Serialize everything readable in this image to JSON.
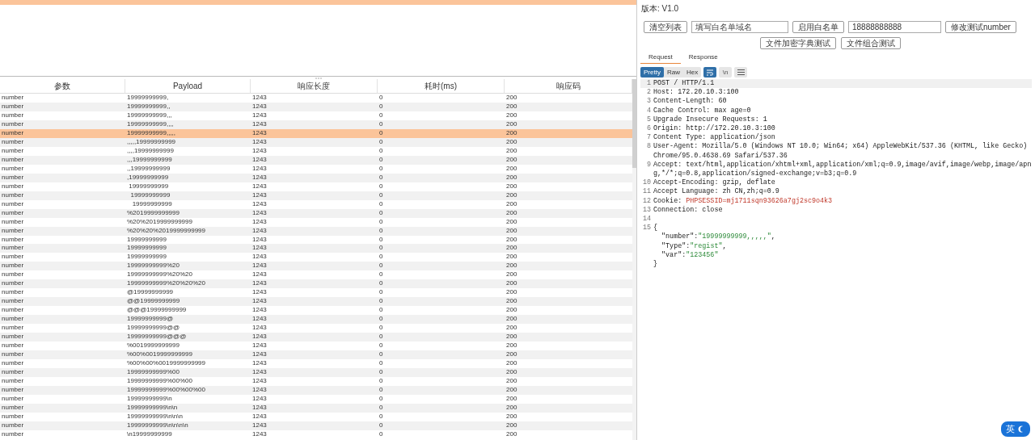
{
  "top_table": {
    "rows": [
      {
        "selected": true
      }
    ]
  },
  "results_table": {
    "columns": [
      "参数",
      "Payload",
      "响应长度",
      "耗时(ms)",
      "响应码"
    ],
    "rows": [
      {
        "selected": false,
        "cells": [
          "number",
          "19999999999,",
          "1243",
          "0",
          "200"
        ]
      },
      {
        "selected": false,
        "cells": [
          "number",
          "19999999999,,",
          "1243",
          "0",
          "200"
        ]
      },
      {
        "selected": false,
        "cells": [
          "number",
          "19999999999,,,",
          "1243",
          "0",
          "200"
        ]
      },
      {
        "selected": false,
        "cells": [
          "number",
          "19999999999,,,,",
          "1243",
          "0",
          "200"
        ]
      },
      {
        "selected": true,
        "cells": [
          "number",
          "19999999999,,,,,",
          "1243",
          "0",
          "200"
        ]
      },
      {
        "selected": false,
        "cells": [
          "number",
          ",,,,,19999999999",
          "1243",
          "0",
          "200"
        ]
      },
      {
        "selected": false,
        "cells": [
          "number",
          ",,,,19999999999",
          "1243",
          "0",
          "200"
        ]
      },
      {
        "selected": false,
        "cells": [
          "number",
          ",,,19999999999",
          "1243",
          "0",
          "200"
        ]
      },
      {
        "selected": false,
        "cells": [
          "number",
          ",,19999999999",
          "1243",
          "0",
          "200"
        ]
      },
      {
        "selected": false,
        "cells": [
          "number",
          ",19999999999",
          "1243",
          "0",
          "200"
        ]
      },
      {
        "selected": false,
        "cells": [
          "number",
          " 19999999999",
          "1243",
          "0",
          "200"
        ]
      },
      {
        "selected": false,
        "cells": [
          "number",
          "  19999999999",
          "1243",
          "0",
          "200"
        ]
      },
      {
        "selected": false,
        "cells": [
          "number",
          "   19999999999",
          "1243",
          "0",
          "200"
        ]
      },
      {
        "selected": false,
        "cells": [
          "number",
          "%2019999999999",
          "1243",
          "0",
          "200"
        ]
      },
      {
        "selected": false,
        "cells": [
          "number",
          "%20%2019999999999",
          "1243",
          "0",
          "200"
        ]
      },
      {
        "selected": false,
        "cells": [
          "number",
          "%20%20%2019999999999",
          "1243",
          "0",
          "200"
        ]
      },
      {
        "selected": false,
        "cells": [
          "number",
          "19999999999",
          "1243",
          "0",
          "200"
        ]
      },
      {
        "selected": false,
        "cells": [
          "number",
          "19999999999",
          "1243",
          "0",
          "200"
        ]
      },
      {
        "selected": false,
        "cells": [
          "number",
          "19999999999",
          "1243",
          "0",
          "200"
        ]
      },
      {
        "selected": false,
        "cells": [
          "number",
          "19999999999%20",
          "1243",
          "0",
          "200"
        ]
      },
      {
        "selected": false,
        "cells": [
          "number",
          "19999999999%20%20",
          "1243",
          "0",
          "200"
        ]
      },
      {
        "selected": false,
        "cells": [
          "number",
          "19999999999%20%20%20",
          "1243",
          "0",
          "200"
        ]
      },
      {
        "selected": false,
        "cells": [
          "number",
          "@19999999999",
          "1243",
          "0",
          "200"
        ]
      },
      {
        "selected": false,
        "cells": [
          "number",
          "@@19999999999",
          "1243",
          "0",
          "200"
        ]
      },
      {
        "selected": false,
        "cells": [
          "number",
          "@@@19999999999",
          "1243",
          "0",
          "200"
        ]
      },
      {
        "selected": false,
        "cells": [
          "number",
          "19999999999@",
          "1243",
          "0",
          "200"
        ]
      },
      {
        "selected": false,
        "cells": [
          "number",
          "19999999999@@",
          "1243",
          "0",
          "200"
        ]
      },
      {
        "selected": false,
        "cells": [
          "number",
          "19999999999@@@",
          "1243",
          "0",
          "200"
        ]
      },
      {
        "selected": false,
        "cells": [
          "number",
          "%0019999999999",
          "1243",
          "0",
          "200"
        ]
      },
      {
        "selected": false,
        "cells": [
          "number",
          "%00%0019999999999",
          "1243",
          "0",
          "200"
        ]
      },
      {
        "selected": false,
        "cells": [
          "number",
          "%00%00%0019999999999",
          "1243",
          "0",
          "200"
        ]
      },
      {
        "selected": false,
        "cells": [
          "number",
          "19999999999%00",
          "1243",
          "0",
          "200"
        ]
      },
      {
        "selected": false,
        "cells": [
          "number",
          "19999999999%00%00",
          "1243",
          "0",
          "200"
        ]
      },
      {
        "selected": false,
        "cells": [
          "number",
          "19999999999%00%00%00",
          "1243",
          "0",
          "200"
        ]
      },
      {
        "selected": false,
        "cells": [
          "number",
          "19999999999\\n",
          "1243",
          "0",
          "200"
        ]
      },
      {
        "selected": false,
        "cells": [
          "number",
          "19999999999\\n\\n",
          "1243",
          "0",
          "200"
        ]
      },
      {
        "selected": false,
        "cells": [
          "number",
          "19999999999\\n\\n\\n",
          "1243",
          "0",
          "200"
        ]
      },
      {
        "selected": false,
        "cells": [
          "number",
          "19999999999\\n\\n\\n\\n",
          "1243",
          "0",
          "200"
        ]
      },
      {
        "selected": false,
        "cells": [
          "number",
          "\\n19999999999",
          "1243",
          "0",
          "200"
        ]
      }
    ]
  },
  "version": "版本: V1.0",
  "controls": [
    {
      "kind": "button",
      "label": "清空列表"
    },
    {
      "kind": "input",
      "placeholder": "填写白名单域名"
    },
    {
      "kind": "button",
      "label": "启用白名单"
    },
    {
      "kind": "input",
      "value": "18888888888"
    },
    {
      "kind": "button",
      "label": "修改测试number"
    }
  ],
  "actions": [
    "文件加密字典测试",
    "文件组合测试"
  ],
  "tabs": [
    {
      "label": "Request",
      "selected": true
    },
    {
      "label": "Response",
      "selected": false
    }
  ],
  "view_modes": [
    {
      "label": "Pretty",
      "selected": true
    },
    {
      "label": "Raw",
      "selected": false
    },
    {
      "label": "Hex",
      "selected": false
    }
  ],
  "toolbar": [
    {
      "kind": "wrap",
      "selected": true
    },
    {
      "kind": "newline",
      "label": "\\n",
      "selected": false
    },
    {
      "kind": "menu",
      "selected": false
    }
  ],
  "request_lines": [
    {
      "number": "1",
      "text": "POST / HTTP/1.1",
      "selected": true
    },
    {
      "number": "2",
      "text": "Host: 172.20.10.3:100",
      "selected": false
    },
    {
      "number": "3",
      "text": "Content-Length: 60",
      "selected": false
    },
    {
      "number": "4",
      "text": "Cache Control: max age=0",
      "selected": false
    },
    {
      "number": "5",
      "text": "Upgrade Insecure Requests: 1",
      "selected": false
    },
    {
      "number": "6",
      "text": "Origin: http://172.20.10.3:100",
      "selected": false
    },
    {
      "number": "7",
      "text": "Content Type: application/json",
      "selected": false
    },
    {
      "number": "8",
      "text": "User-Agent: Mozilla/5.0 (Windows NT 10.0; Win64; x64) AppleWebKit/537.36 (KHTML, like Gecko) Chrome/95.0.4638.69 Safari/537.36",
      "selected": false
    },
    {
      "number": "9",
      "text": "Accept: text/html,application/xhtml+xml,application/xml;q=0.9,image/avif,image/webp,image/apng,*/*;q=0.8,application/signed-exchange;v=b3;q=0.9",
      "selected": false
    },
    {
      "number": "10",
      "text": "Accept-Encoding: gzip, deflate",
      "selected": false
    },
    {
      "number": "11",
      "text": "Accept Language: zh CN,zh;q=0.9",
      "selected": false
    },
    {
      "number": "12",
      "text": "Cookie: ",
      "value": "PHPSESSID=mj1711sqn93626a7gj2sc9o4k3",
      "kind": "cookie",
      "selected": false
    },
    {
      "number": "13",
      "text": "Connection: close",
      "selected": false
    },
    {
      "number": "14",
      "selected": false
    },
    {
      "number": "15",
      "text": "{",
      "selected": false
    },
    {
      "text": "  \"number\":",
      "value": "\"19999999999,,,,,\"",
      "suffix": ",",
      "kind": "json",
      "selected": false
    },
    {
      "text": "  \"Type\":",
      "value": "\"regist\"",
      "suffix": ",",
      "kind": "json",
      "selected": false
    },
    {
      "text": "  \"var\":",
      "value": "\"123456\"",
      "kind": "json",
      "selected": false
    },
    {
      "text": "}",
      "selected": false
    }
  ],
  "ime_indicator": "英"
}
